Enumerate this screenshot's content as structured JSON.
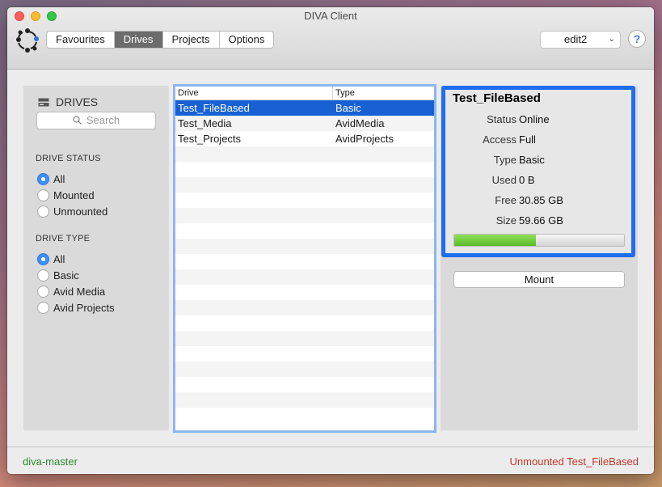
{
  "window": {
    "title": "DIVA Client"
  },
  "toolbar": {
    "tabs": [
      {
        "label": "Favourites",
        "active": false
      },
      {
        "label": "Drives",
        "active": true
      },
      {
        "label": "Projects",
        "active": false
      },
      {
        "label": "Options",
        "active": false
      }
    ],
    "server_select": "edit2",
    "help_label": "?"
  },
  "sidebar": {
    "title": "DRIVES",
    "search_placeholder": "Search",
    "drive_status": {
      "label": "DRIVE STATUS",
      "options": [
        {
          "label": "All",
          "checked": true
        },
        {
          "label": "Mounted",
          "checked": false
        },
        {
          "label": "Unmounted",
          "checked": false
        }
      ]
    },
    "drive_type": {
      "label": "DRIVE TYPE",
      "options": [
        {
          "label": "All",
          "checked": true
        },
        {
          "label": "Basic",
          "checked": false
        },
        {
          "label": "Avid Media",
          "checked": false
        },
        {
          "label": "Avid Projects",
          "checked": false
        }
      ]
    }
  },
  "table": {
    "columns": [
      "Drive",
      "Type"
    ],
    "rows": [
      {
        "drive": "Test_FileBased",
        "type": "Basic",
        "selected": true
      },
      {
        "drive": "Test_Media",
        "type": "AvidMedia",
        "selected": false
      },
      {
        "drive": "Test_Projects",
        "type": "AvidProjects",
        "selected": false
      }
    ]
  },
  "detail": {
    "title": "Test_FileBased",
    "fields": [
      {
        "label": "Status",
        "value": "Online"
      },
      {
        "label": "Access",
        "value": "Full"
      },
      {
        "label": "Type",
        "value": "Basic"
      },
      {
        "label": "Used",
        "value": "0 B"
      },
      {
        "label": "Free",
        "value": "30.85 GB"
      },
      {
        "label": "Size",
        "value": "59.66 GB"
      }
    ],
    "progress_fraction": 0.48,
    "mount_label": "Mount"
  },
  "status": {
    "left": "diva-master",
    "right": "Unmounted Test_FileBased"
  },
  "colors": {
    "accent": "#1e6df0",
    "selection": "#1861d5",
    "status_ok": "#2e8b2e",
    "status_error": "#c0392b",
    "progress_fill": "#6cc83a"
  }
}
